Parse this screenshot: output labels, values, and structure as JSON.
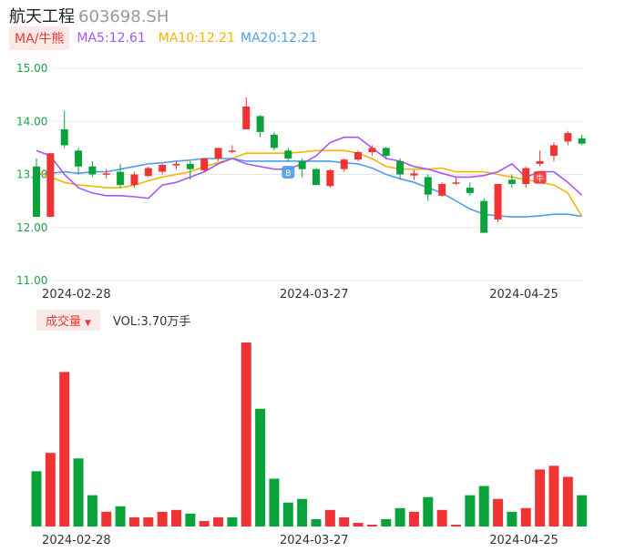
{
  "header": {
    "name": "航天工程",
    "code": "603698.SH"
  },
  "legend": {
    "tag": "MA/牛熊",
    "ma5": "MA5:12.61",
    "ma10": "MA10:12.21",
    "ma20": "MA20:12.21"
  },
  "volume_legend": {
    "tag": "成交量",
    "arrow": "▼",
    "vol": "VOL:3.70万手"
  },
  "colors": {
    "up": "#f03434",
    "down": "#0aa33b",
    "ma5": "#a855f7",
    "ma10": "#f5b400",
    "ma20": "#4d9fe8",
    "axis_label": "#1a9f4a",
    "grid": "#e8e8e8"
  },
  "chart_data": [
    {
      "type": "candlestick",
      "y_ticks": [
        "15.00",
        "14.00",
        "13.00",
        "12.00",
        "11.00"
      ],
      "ylim": [
        11,
        15
      ],
      "x_tick_labels": [
        "2024-02-28",
        "2024-03-27",
        "2024-04-25"
      ],
      "x_tick_indices": [
        3,
        20,
        35
      ],
      "grid": true,
      "markers": [
        {
          "index": 18,
          "label": "B",
          "color": "#4d9fe8"
        },
        {
          "index": 36,
          "label": "牛",
          "color": "#f03434"
        }
      ],
      "candles": [
        {
          "o": 13.15,
          "c": 12.2,
          "h": 13.3,
          "l": 12.2
        },
        {
          "o": 12.2,
          "c": 13.4,
          "h": 13.4,
          "l": 12.2
        },
        {
          "o": 13.85,
          "c": 13.55,
          "h": 14.2,
          "l": 13.5
        },
        {
          "o": 13.45,
          "c": 13.15,
          "h": 13.5,
          "l": 13.0
        },
        {
          "o": 13.15,
          "c": 13.0,
          "h": 13.25,
          "l": 12.95
        },
        {
          "o": 13.0,
          "c": 13.02,
          "h": 13.1,
          "l": 12.92
        },
        {
          "o": 13.05,
          "c": 12.8,
          "h": 13.2,
          "l": 12.75
        },
        {
          "o": 12.8,
          "c": 13.0,
          "h": 13.05,
          "l": 12.75
        },
        {
          "o": 12.97,
          "c": 13.12,
          "h": 13.15,
          "l": 12.95
        },
        {
          "o": 13.05,
          "c": 13.18,
          "h": 13.2,
          "l": 13.0
        },
        {
          "o": 13.17,
          "c": 13.2,
          "h": 13.25,
          "l": 13.1
        },
        {
          "o": 13.2,
          "c": 13.1,
          "h": 13.25,
          "l": 12.9
        },
        {
          "o": 13.08,
          "c": 13.3,
          "h": 13.3,
          "l": 13.05
        },
        {
          "o": 13.3,
          "c": 13.5,
          "h": 13.5,
          "l": 13.25
        },
        {
          "o": 13.45,
          "c": 13.45,
          "h": 13.55,
          "l": 13.4
        },
        {
          "o": 13.85,
          "c": 14.28,
          "h": 14.45,
          "l": 13.85
        },
        {
          "o": 14.1,
          "c": 13.8,
          "h": 14.12,
          "l": 13.7
        },
        {
          "o": 13.75,
          "c": 13.5,
          "h": 13.8,
          "l": 13.45
        },
        {
          "o": 13.45,
          "c": 13.3,
          "h": 13.5,
          "l": 13.25
        },
        {
          "o": 13.25,
          "c": 13.1,
          "h": 13.3,
          "l": 12.95
        },
        {
          "o": 13.1,
          "c": 12.8,
          "h": 13.12,
          "l": 12.8
        },
        {
          "o": 12.78,
          "c": 13.08,
          "h": 13.1,
          "l": 12.75
        },
        {
          "o": 13.1,
          "c": 13.28,
          "h": 13.3,
          "l": 13.05
        },
        {
          "o": 13.28,
          "c": 13.42,
          "h": 13.45,
          "l": 13.25
        },
        {
          "o": 13.42,
          "c": 13.5,
          "h": 13.55,
          "l": 13.35
        },
        {
          "o": 13.5,
          "c": 13.35,
          "h": 13.52,
          "l": 13.3
        },
        {
          "o": 13.25,
          "c": 13.0,
          "h": 13.3,
          "l": 12.9
        },
        {
          "o": 12.98,
          "c": 13.02,
          "h": 13.08,
          "l": 12.9
        },
        {
          "o": 12.95,
          "c": 12.62,
          "h": 13.0,
          "l": 12.5
        },
        {
          "o": 12.6,
          "c": 12.82,
          "h": 12.85,
          "l": 12.58
        },
        {
          "o": 12.83,
          "c": 12.85,
          "h": 12.95,
          "l": 12.8
        },
        {
          "o": 12.75,
          "c": 12.65,
          "h": 12.85,
          "l": 12.6
        },
        {
          "o": 12.5,
          "c": 11.9,
          "h": 12.55,
          "l": 11.9
        },
        {
          "o": 12.15,
          "c": 12.82,
          "h": 12.82,
          "l": 12.1
        },
        {
          "o": 12.9,
          "c": 12.82,
          "h": 13.0,
          "l": 12.75
        },
        {
          "o": 12.82,
          "c": 13.12,
          "h": 13.15,
          "l": 12.75
        },
        {
          "o": 13.2,
          "c": 13.25,
          "h": 13.45,
          "l": 13.15
        },
        {
          "o": 13.35,
          "c": 13.55,
          "h": 13.6,
          "l": 13.25
        },
        {
          "o": 13.62,
          "c": 13.78,
          "h": 13.82,
          "l": 13.55
        },
        {
          "o": 13.68,
          "c": 13.58,
          "h": 13.75,
          "l": 13.55
        }
      ],
      "ma5": [
        13.45,
        13.35,
        13.0,
        12.75,
        12.65,
        12.6,
        12.6,
        12.58,
        12.55,
        12.8,
        12.85,
        12.95,
        13.05,
        13.2,
        13.3,
        13.2,
        13.15,
        13.1,
        13.1,
        13.2,
        13.35,
        13.6,
        13.7,
        13.7,
        13.5,
        13.3,
        13.25,
        13.15,
        13.1,
        13.02,
        12.95,
        12.95,
        12.98,
        13.05,
        13.2,
        12.95,
        13.05,
        13.05,
        12.85,
        12.61
      ],
      "ma10": [
        13.05,
        12.95,
        12.85,
        12.8,
        12.78,
        12.75,
        12.75,
        12.8,
        12.88,
        12.95,
        13.0,
        13.05,
        13.15,
        13.22,
        13.3,
        13.4,
        13.4,
        13.4,
        13.4,
        13.42,
        13.45,
        13.45,
        13.45,
        13.4,
        13.3,
        13.15,
        13.1,
        13.1,
        13.1,
        13.12,
        13.05,
        13.05,
        13.05,
        13.0,
        12.95,
        12.9,
        12.85,
        12.8,
        12.65,
        12.21
      ],
      "ma20": [
        13.0,
        13.02,
        13.05,
        13.02,
        13.05,
        13.05,
        13.1,
        13.15,
        13.2,
        13.22,
        13.25,
        13.27,
        13.3,
        13.3,
        13.3,
        13.25,
        13.25,
        13.25,
        13.25,
        13.25,
        13.25,
        13.25,
        13.22,
        13.2,
        13.12,
        13.0,
        12.92,
        12.85,
        12.75,
        12.65,
        12.5,
        12.35,
        12.25,
        12.22,
        12.2,
        12.2,
        12.22,
        12.25,
        12.25,
        12.21
      ]
    },
    {
      "type": "bar",
      "title": "成交量",
      "x_tick_labels": [
        "2024-02-28",
        "2024-03-27",
        "2024-04-25"
      ],
      "x_tick_indices": [
        3,
        20,
        35
      ],
      "ymax": 1.0,
      "values": [
        0.3,
        0.4,
        0.84,
        0.37,
        0.17,
        0.08,
        0.11,
        0.05,
        0.05,
        0.08,
        0.09,
        0.07,
        0.03,
        0.05,
        0.05,
        1.0,
        0.64,
        0.26,
        0.13,
        0.15,
        0.04,
        0.09,
        0.05,
        0.02,
        0.01,
        0.04,
        0.1,
        0.08,
        0.16,
        0.09,
        0.01,
        0.17,
        0.22,
        0.15,
        0.08,
        0.1,
        0.31,
        0.33,
        0.27,
        0.17
      ],
      "up": [
        false,
        true,
        true,
        false,
        false,
        true,
        false,
        true,
        true,
        true,
        true,
        false,
        true,
        true,
        false,
        true,
        false,
        false,
        false,
        false,
        false,
        true,
        true,
        true,
        true,
        false,
        false,
        true,
        false,
        true,
        true,
        false,
        false,
        true,
        false,
        true,
        true,
        true,
        true,
        false
      ]
    }
  ]
}
